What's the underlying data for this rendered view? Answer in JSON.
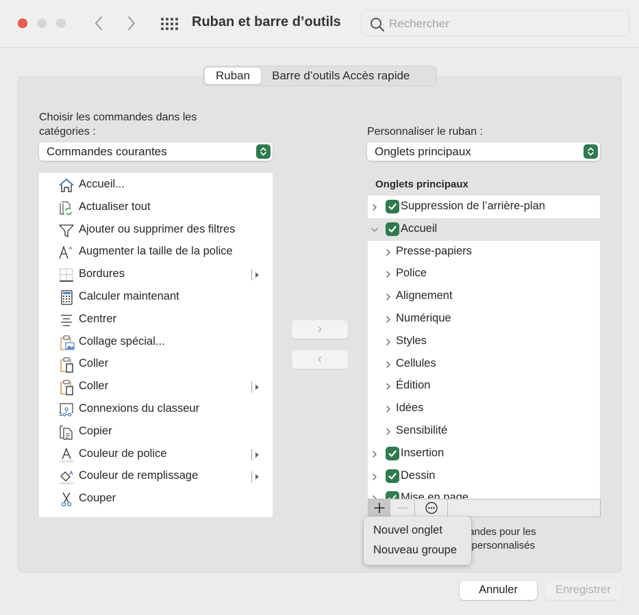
{
  "window": {
    "title": "Ruban et barre d’outils",
    "search_placeholder": "Rechercher",
    "search_value": ""
  },
  "tabs": [
    {
      "label": "Ruban",
      "active": true
    },
    {
      "label": "Barre d’outils Accès rapide",
      "active": false
    }
  ],
  "left": {
    "label_line1": "Choisir les commandes dans les",
    "label_line2": "catégories :",
    "dropdown_value": "Commandes courantes",
    "commands": [
      {
        "label": "Accueil...",
        "icon": "home-icon",
        "submenu": false
      },
      {
        "label": "Actualiser tout",
        "icon": "refresh-all-icon",
        "submenu": false
      },
      {
        "label": "Ajouter ou supprimer des filtres",
        "icon": "filter-icon",
        "submenu": false
      },
      {
        "label": "Augmenter la taille de la police",
        "icon": "increase-font-icon",
        "submenu": false
      },
      {
        "label": "Bordures",
        "icon": "borders-icon",
        "submenu": true
      },
      {
        "label": "Calculer maintenant",
        "icon": "calculator-icon",
        "submenu": false
      },
      {
        "label": "Centrer",
        "icon": "align-center-icon",
        "submenu": false
      },
      {
        "label": "Collage spécial...",
        "icon": "paste-special-icon",
        "submenu": false
      },
      {
        "label": "Coller",
        "icon": "paste-icon",
        "submenu": false
      },
      {
        "label": "Coller",
        "icon": "paste-icon",
        "submenu": true
      },
      {
        "label": "Connexions du classeur",
        "icon": "workbook-connections-icon",
        "submenu": false
      },
      {
        "label": "Copier",
        "icon": "copy-icon",
        "submenu": false
      },
      {
        "label": "Couleur de police",
        "icon": "font-color-icon",
        "submenu": true
      },
      {
        "label": "Couleur de remplissage",
        "icon": "fill-color-icon",
        "submenu": true
      },
      {
        "label": "Couper",
        "icon": "scissors-icon",
        "submenu": false
      }
    ]
  },
  "move_buttons": {
    "add": "›",
    "remove": "‹"
  },
  "right": {
    "label": "Personnaliser le ruban :",
    "dropdown_value": "Onglets principaux",
    "tree_header": "Onglets principaux",
    "rows": [
      {
        "label": "Suppression de l’arrière-plan",
        "level": 0,
        "checked": true,
        "expanded": false,
        "selected": false
      },
      {
        "label": "Accueil",
        "level": 0,
        "checked": true,
        "expanded": true,
        "selected": true
      },
      {
        "label": "Presse-papiers",
        "level": 1
      },
      {
        "label": "Police",
        "level": 1
      },
      {
        "label": "Alignement",
        "level": 1
      },
      {
        "label": "Numérique",
        "level": 1
      },
      {
        "label": "Styles",
        "level": 1
      },
      {
        "label": "Cellules",
        "level": 1
      },
      {
        "label": "Édition",
        "level": 1
      },
      {
        "label": "Idées",
        "level": 1
      },
      {
        "label": "Sensibilité",
        "level": 1
      },
      {
        "label": "Insertion",
        "level": 0,
        "checked": true,
        "expanded": false,
        "selected": false
      },
      {
        "label": "Dessin",
        "level": 0,
        "checked": true,
        "expanded": false,
        "selected": false
      },
      {
        "label": "Mise en page",
        "level": 0,
        "checked": true,
        "expanded": false,
        "selected": false
      }
    ],
    "description_line1": "Commandes pour les",
    "description_line2": "onglets personnalisés"
  },
  "add_menu": {
    "items": [
      "Nouvel onglet",
      "Nouveau groupe"
    ]
  },
  "footer": {
    "cancel_label": "Annuler",
    "save_label": "Enregistrer"
  },
  "colors": {
    "accent_green": "#2f7a4e",
    "close_red": "#ee5e55"
  }
}
